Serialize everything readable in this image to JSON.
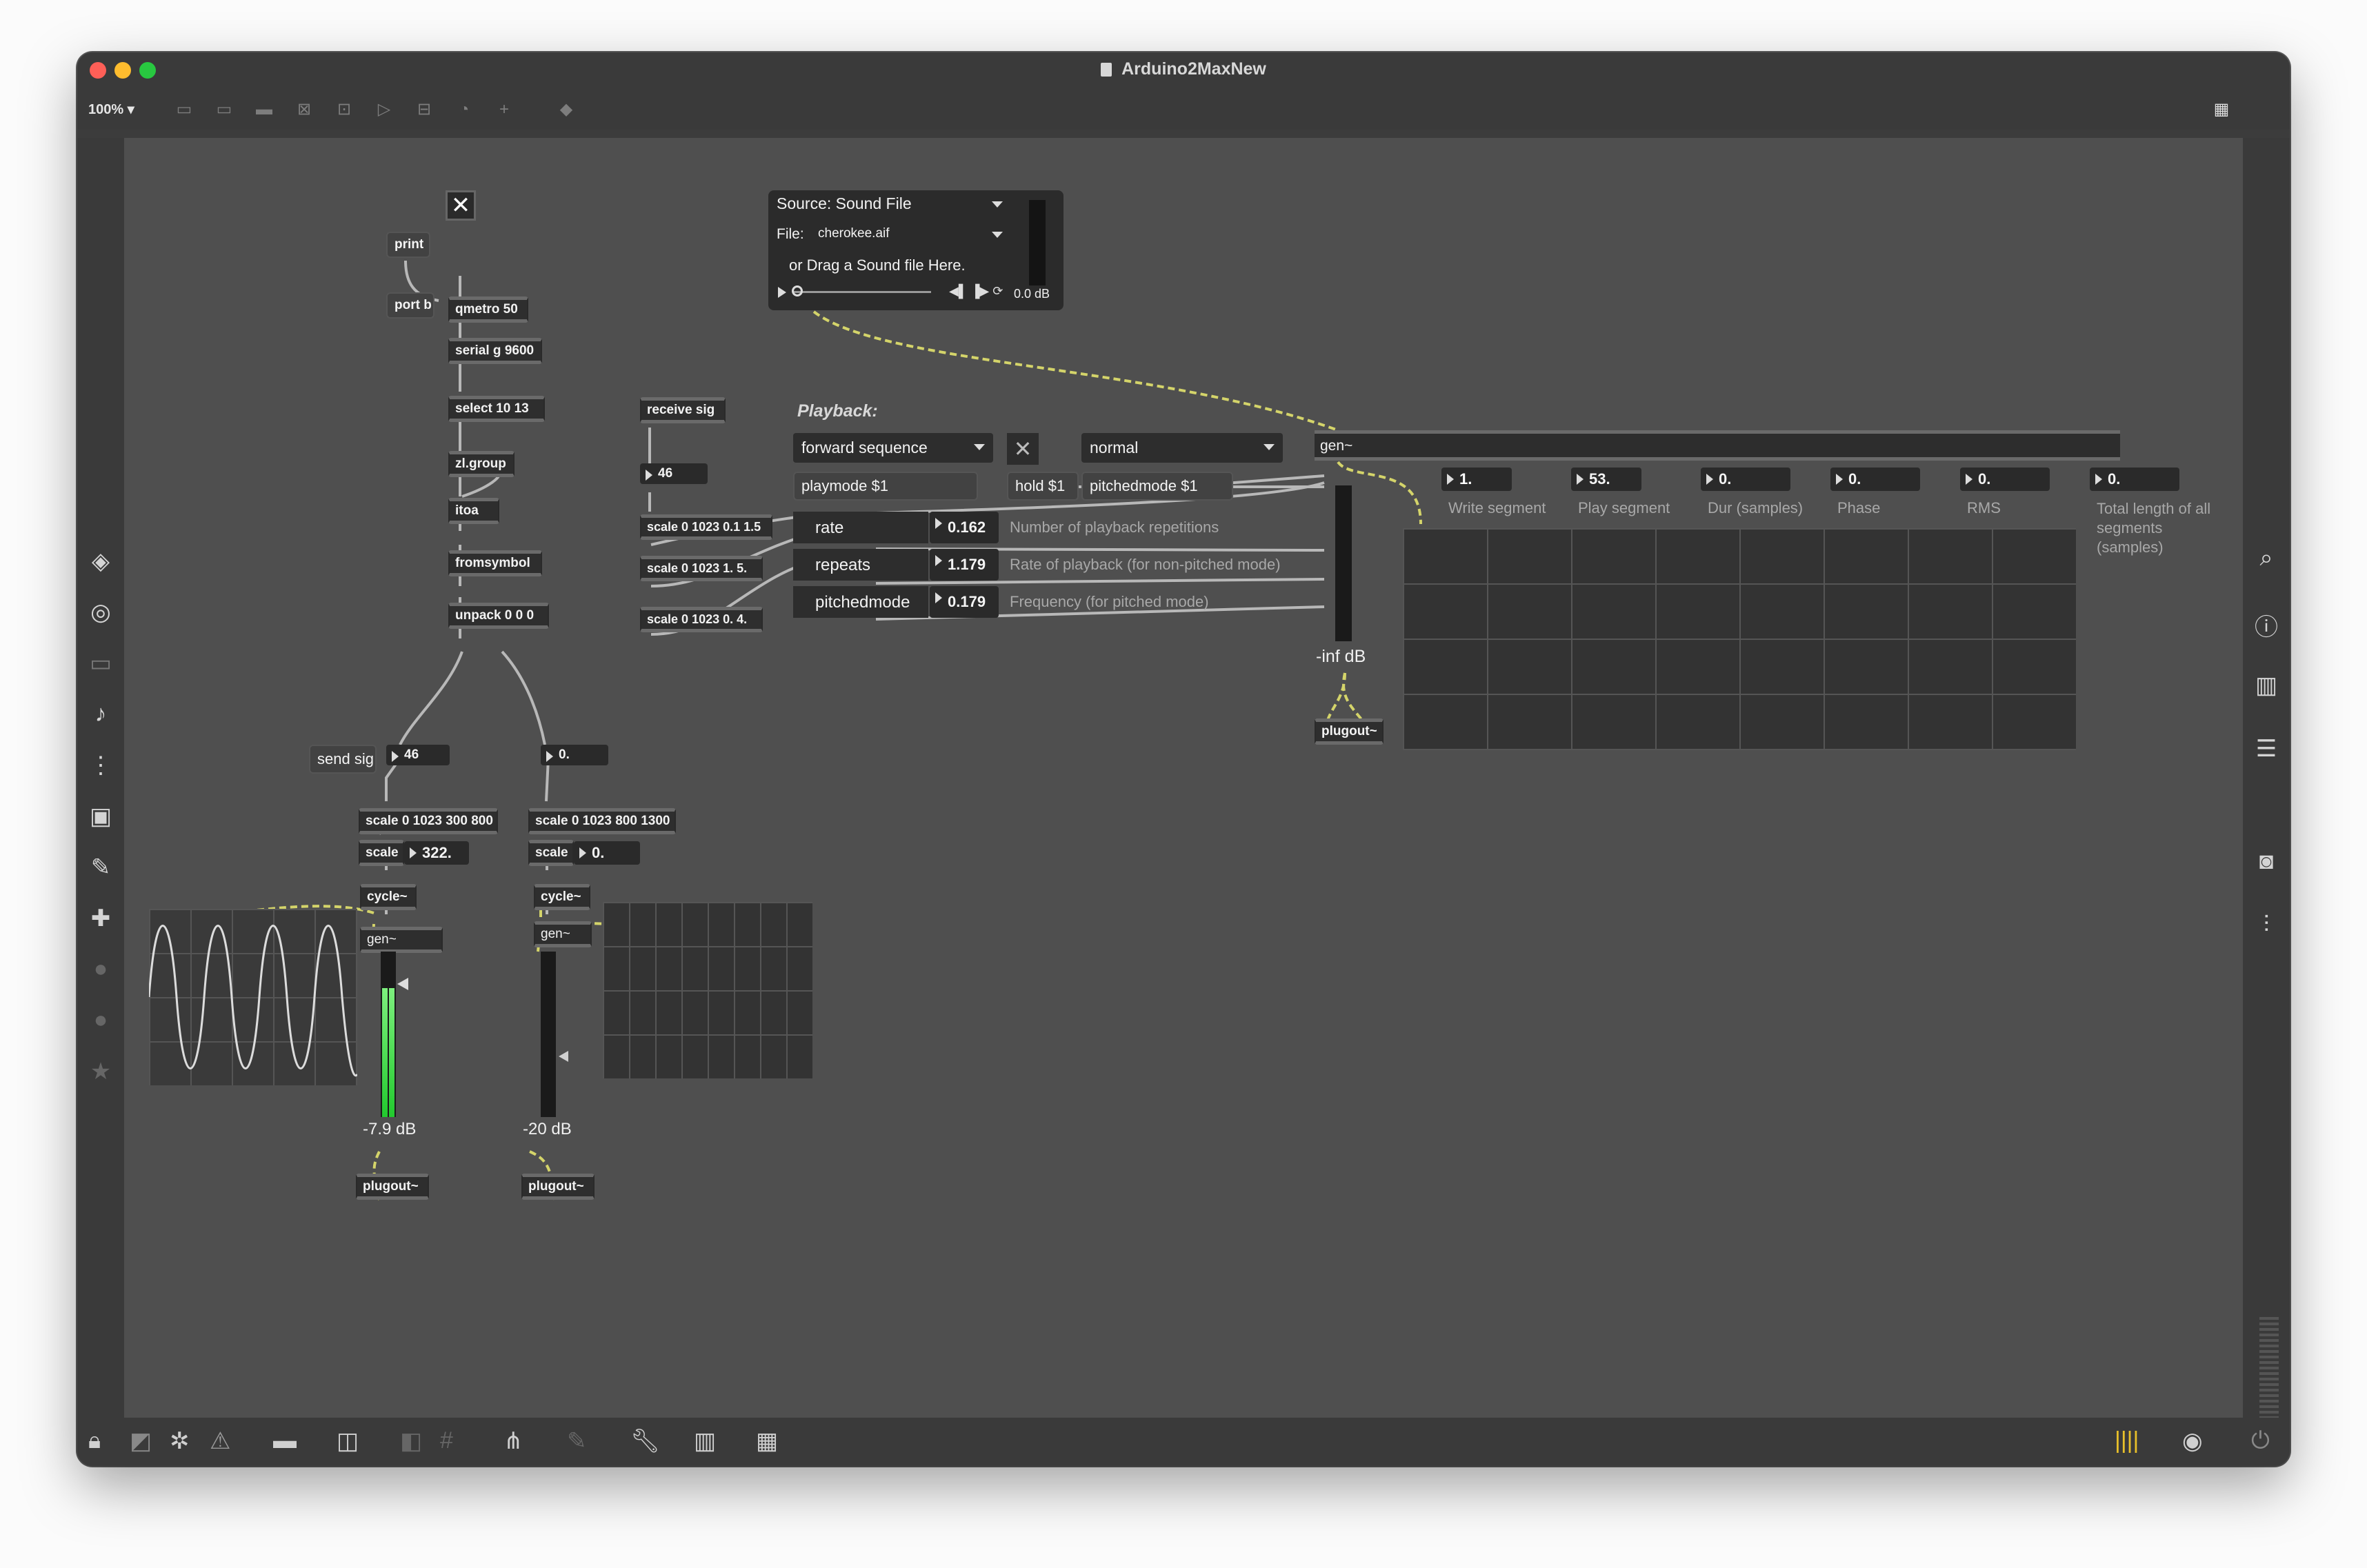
{
  "window": {
    "title": "Arduino2MaxNew",
    "zoom": "100%"
  },
  "colors": {
    "canvas": "#4f4f4f",
    "signal_wire": "#d4d46a",
    "meter_green": "#34d34a"
  },
  "objects": {
    "print": "print",
    "port_b": "port b",
    "qmetro": "qmetro 50",
    "serial": "serial g 9600",
    "select": "select 10 13",
    "zlgroup": "zl.group",
    "itoa": "itoa",
    "fromsymbol": "fromsymbol",
    "unpack": "unpack 0 0 0",
    "send_sig": "send sig",
    "receive_sig": "receive sig",
    "scale_rate": "scale 0 1023 0.1 1.5",
    "scale_repeats": "scale 0 1023 1. 5.",
    "scale_pitch": "scale 0 1023 0. 4.",
    "scale_left": "scale 0 1023 300 800",
    "scale_right": "scale 0 1023 800 1300",
    "scale_small_left": "scale",
    "scale_small_right": "scale",
    "cycle_left": "cycle~",
    "cycle_right": "cycle~",
    "gen_left": "gen~",
    "gen_right": "gen~",
    "gen_main": "gen~",
    "plugout_left": "plugout~",
    "plugout_right": "plugout~",
    "plugout_main": "plugout~"
  },
  "numbers": {
    "n46_top": "46",
    "n46_left": "46",
    "n0_right": "0.",
    "n322": "322.",
    "n0_scale": "0."
  },
  "meters": {
    "left_db": "-7.9 dB",
    "left_level": 0.78,
    "right_db": "-20 dB",
    "main_db": "-inf dB"
  },
  "playlist": {
    "source": "Source: Sound File",
    "file_label": "File:",
    "file": "cherokee.aif",
    "drag": "or Drag a Sound file Here.",
    "db": "0.0 dB"
  },
  "playback": {
    "heading": "Playback:",
    "mode_menu": "forward sequence",
    "pitch_menu": "normal",
    "playmode": "playmode $1",
    "hold": "hold $1",
    "pitchedmode": "pitchedmode $1",
    "params": [
      {
        "name": "rate",
        "value": "0.162",
        "desc": "Number of playback repetitions"
      },
      {
        "name": "repeats",
        "value": "1.179",
        "desc": "Rate of playback (for non-pitched mode)"
      },
      {
        "name": "pitchedmode",
        "value": "0.179",
        "desc": "Frequency (for pitched mode)"
      }
    ]
  },
  "outputs": [
    {
      "value": "1.",
      "label": "Write segment"
    },
    {
      "value": "53.",
      "label": "Play segment"
    },
    {
      "value": "0.",
      "label": "Dur (samples)"
    },
    {
      "value": "0.",
      "label": "Phase"
    },
    {
      "value": "0.",
      "label": "RMS"
    },
    {
      "value": "0.",
      "label": "Total length of all segments (samples)"
    }
  ]
}
